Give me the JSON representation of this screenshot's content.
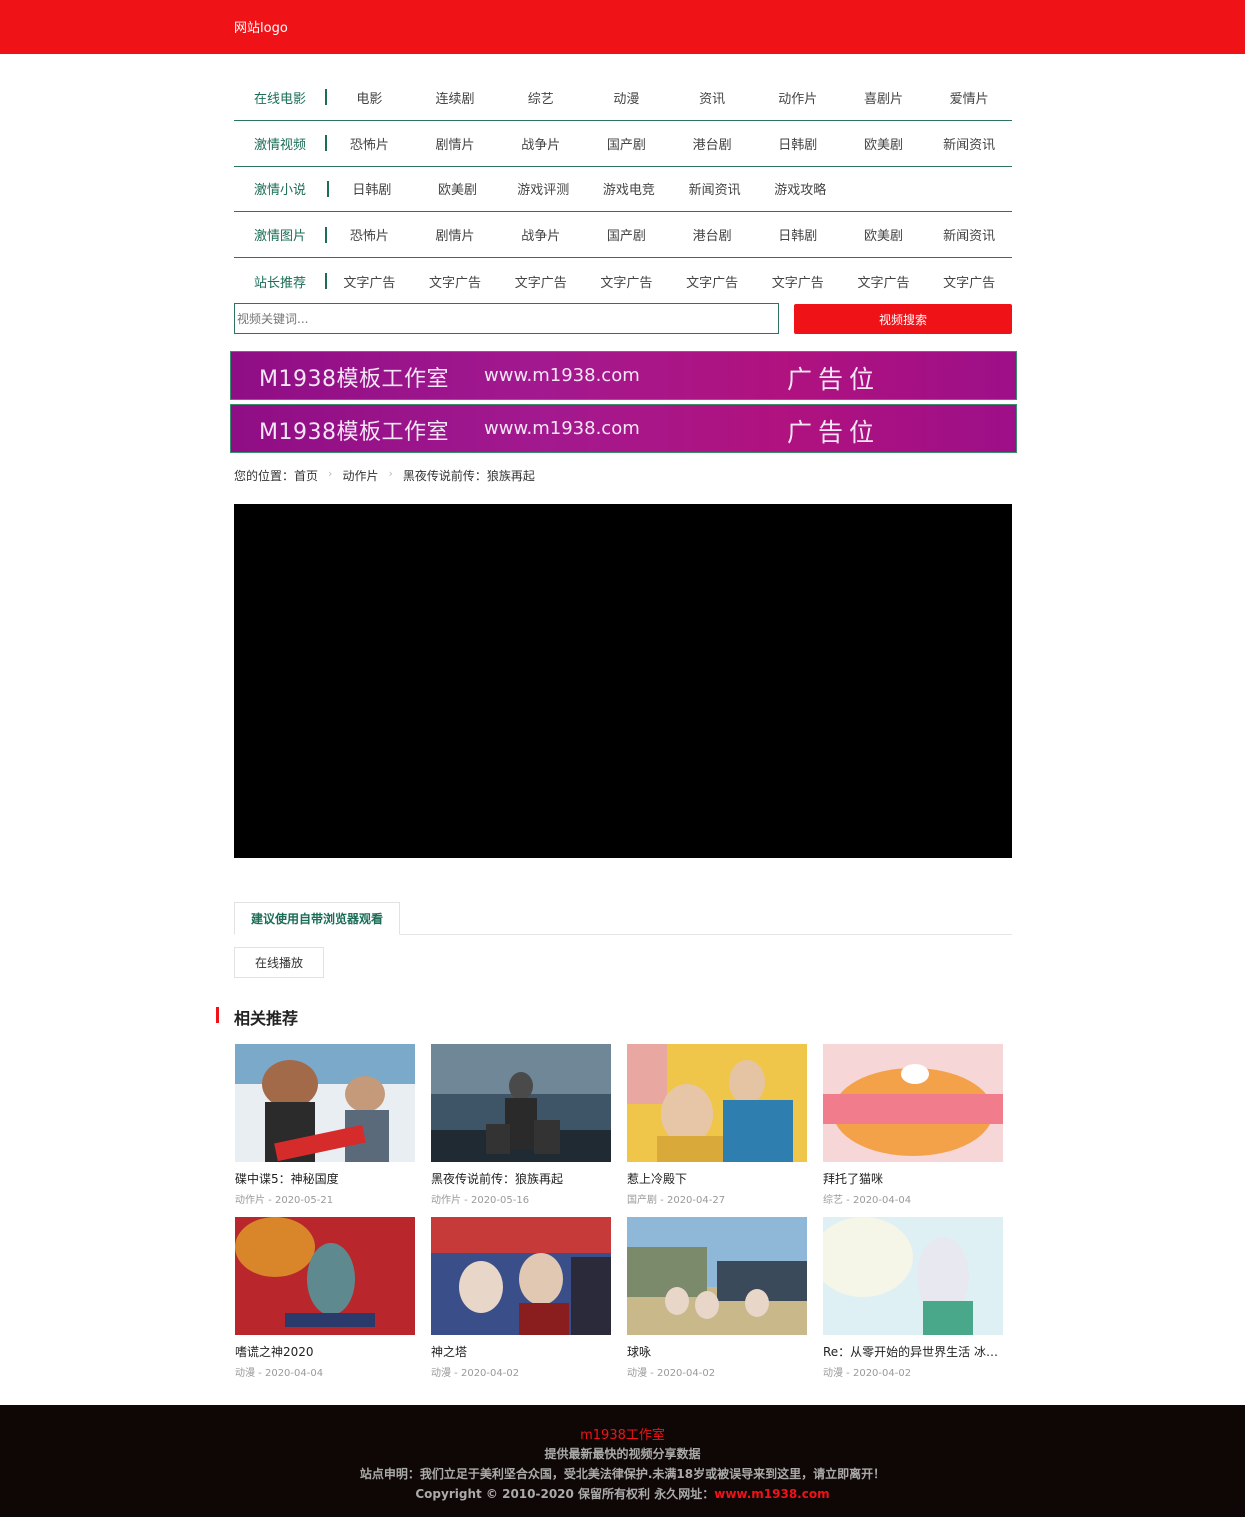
{
  "header": {
    "logo_text": "网站logo"
  },
  "nav": {
    "rows": [
      {
        "category": "在线电影",
        "items": [
          "电影",
          "连续剧",
          "综艺",
          "动漫",
          "资讯",
          "动作片",
          "喜剧片",
          "爱情片"
        ]
      },
      {
        "category": "激情视频",
        "items": [
          "恐怖片",
          "剧情片",
          "战争片",
          "国产剧",
          "港台剧",
          "日韩剧",
          "欧美剧",
          "新闻资讯"
        ]
      },
      {
        "category": "激情小说",
        "items": [
          "日韩剧",
          "欧美剧",
          "游戏评测",
          "游戏电竞",
          "新闻资讯",
          "游戏攻略"
        ]
      },
      {
        "category": "激情图片",
        "items": [
          "恐怖片",
          "剧情片",
          "战争片",
          "国产剧",
          "港台剧",
          "日韩剧",
          "欧美剧",
          "新闻资讯"
        ]
      },
      {
        "category": "站长推荐",
        "items": [
          "文字广告",
          "文字广告",
          "文字广告",
          "文字广告",
          "文字广告",
          "文字广告",
          "文字广告",
          "文字广告"
        ]
      }
    ]
  },
  "search": {
    "placeholder": "视频关键词...",
    "button_label": "视频搜索"
  },
  "ads": [
    {
      "brand": "M1938模板工作室",
      "url": "www.m1938.com",
      "label": "广告位"
    },
    {
      "brand": "M1938模板工作室",
      "url": "www.m1938.com",
      "label": "广告位"
    }
  ],
  "breadcrumb": {
    "prefix": "您的位置：",
    "home": "首页",
    "category": "动作片",
    "current": "黑夜传说前传：狼族再起"
  },
  "player_tabs": {
    "tab_label": "建议使用自带浏览器观看",
    "play_button": "在线播放"
  },
  "related": {
    "title": "相关推荐",
    "items": [
      {
        "title": "碟中谍5：神秘国度",
        "meta": "动作片 - 2020-05-21"
      },
      {
        "title": "黑夜传说前传：狼族再起",
        "meta": "动作片 - 2020-05-16"
      },
      {
        "title": "惹上冷殿下",
        "meta": "国产剧 - 2020-04-27"
      },
      {
        "title": "拜托了猫咪",
        "meta": "综艺 - 2020-04-04"
      },
      {
        "title": "嗜谎之神2020",
        "meta": "动漫 - 2020-04-04"
      },
      {
        "title": "神之塔",
        "meta": "动漫 - 2020-04-02"
      },
      {
        "title": "球咏",
        "meta": "动漫 - 2020-04-02"
      },
      {
        "title": "Re：从零开始的异世界生活 冰结...",
        "meta": "动漫 - 2020-04-02"
      }
    ]
  },
  "footer": {
    "studio": "m1938工作室",
    "slogan": "提供最新最快的视频分享数据",
    "disclaimer": "站点申明：我们立足于美利坚合众国，受北美法律保护.未满18岁或被误导来到这里，请立即离开！",
    "copyright": "Copyright © 2010-2020 保留所有权利 永久网址：",
    "site_url": "www.m1938.com"
  },
  "colors": {
    "brand_red": "#ef1318",
    "nav_green": "#1b6d57",
    "footer_bg": "#0f0606"
  }
}
